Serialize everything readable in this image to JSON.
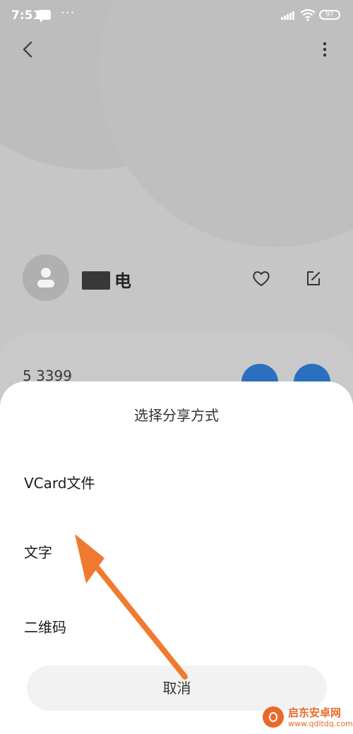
{
  "status_bar": {
    "time": "7:51",
    "dots": "···",
    "battery": "97"
  },
  "contact": {
    "name": "电",
    "phone": "5 3399"
  },
  "sheet": {
    "title": "选择分享方式",
    "options": [
      "VCard文件",
      "文字",
      "二维码"
    ],
    "cancel_label": "取消"
  },
  "watermark": {
    "title": "启东安卓网",
    "url": "www.qdltdq.com"
  },
  "colors": {
    "accent": "#2a6fc0",
    "arrow": "#f07a30",
    "sheet_bg": "#ffffff",
    "overlay_bg": "#c6c6c6"
  },
  "icons": [
    "back-icon",
    "more-icon",
    "avatar-person-icon",
    "heart-icon",
    "edit-icon",
    "phone-icon",
    "message-icon",
    "signal-icon",
    "wifi-icon",
    "battery-icon"
  ]
}
